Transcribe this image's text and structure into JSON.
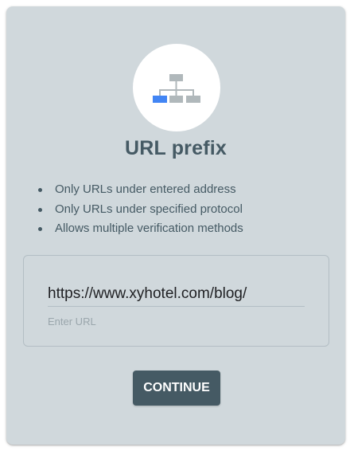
{
  "card": {
    "title": "URL prefix",
    "bullets": [
      "Only URLs under entered address",
      "Only URLs under specified protocol",
      "Allows multiple verification methods"
    ],
    "url_input": {
      "value": "https://www.xyhotel.com/blog/",
      "helper": "Enter URL"
    },
    "continue_label": "CONTINUE"
  },
  "icon": {
    "name": "sitemap-icon",
    "accent_color": "#4285f4",
    "node_color": "#b0b8bb"
  },
  "colors": {
    "card_background": "#d0d8dc",
    "text": "#455a64",
    "button": "#455a64"
  }
}
